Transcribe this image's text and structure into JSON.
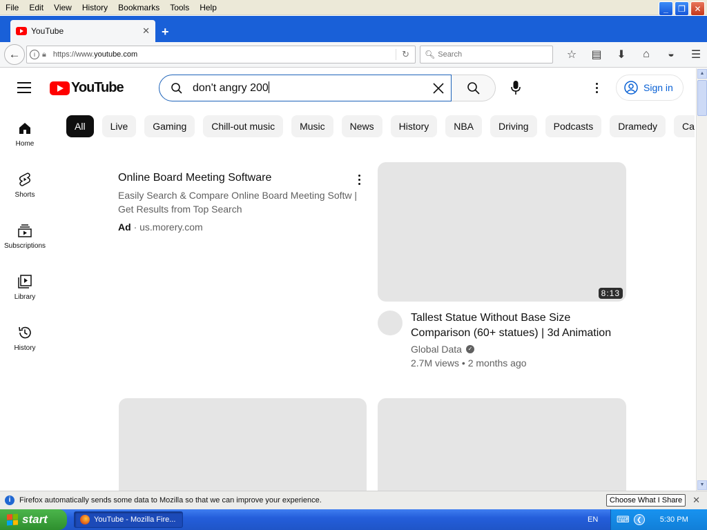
{
  "menubar": {
    "items": [
      "File",
      "Edit",
      "View",
      "History",
      "Bookmarks",
      "Tools",
      "Help"
    ]
  },
  "window_controls": {
    "minimize": "_",
    "maximize": "❐",
    "close": "✕"
  },
  "tab": {
    "title": "YouTube",
    "new_tab": "+"
  },
  "navbar": {
    "url_prefix": "https://www.",
    "url_domain": "youtube.com",
    "search_placeholder": "Search"
  },
  "youtube": {
    "logo_text": "YouTube",
    "search_query": "don't angry 200",
    "sign_in": "Sign in",
    "chips": [
      "All",
      "Live",
      "Gaming",
      "Chill-out music",
      "Music",
      "News",
      "History",
      "NBA",
      "Driving",
      "Podcasts",
      "Dramedy",
      "Car"
    ],
    "guide": [
      {
        "label": "Home",
        "icon": "home-icon"
      },
      {
        "label": "Shorts",
        "icon": "shorts-icon"
      },
      {
        "label": "Subscriptions",
        "icon": "subscriptions-icon"
      },
      {
        "label": "Library",
        "icon": "library-icon"
      },
      {
        "label": "History",
        "icon": "history-icon"
      }
    ],
    "ad": {
      "title": "Online Board Meeting Software",
      "description": "Easily Search & Compare Online Board Meeting Softw | Get Results from Top Search",
      "badge": "Ad",
      "separator": "·",
      "domain": "us.morery.com"
    },
    "video": {
      "duration": "8:13",
      "title": "Tallest Statue Without Base Size Comparison (60+ statues) | 3d Animation",
      "channel": "Global Data",
      "stats": "2.7M views • 2 months ago"
    }
  },
  "notification": {
    "text": "Firefox automatically sends some data to Mozilla so that we can improve your experience.",
    "button": "Choose What I Share"
  },
  "taskbar": {
    "start": "start",
    "task": "YouTube - Mozilla Fire...",
    "language": "EN",
    "time": "5:30 PM"
  },
  "colors": {
    "xp_blue": "#1960d8",
    "youtube_red": "#ff0000",
    "link_blue": "#065fd4",
    "start_green": "#3a9f3a"
  }
}
